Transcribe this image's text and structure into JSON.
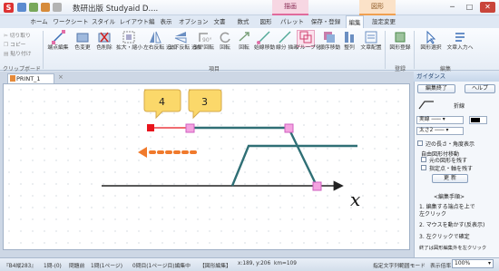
{
  "titlebar": {
    "app_badge": "S",
    "title": "数研出版 Studyaid D....",
    "ctx_drawing": "描画",
    "ctx_shape": "図形",
    "win_min": "─",
    "win_max": "□",
    "win_close": "✕"
  },
  "tabs": [
    {
      "label": "ホーム"
    },
    {
      "label": "ワークシート"
    },
    {
      "label": "スタイル"
    },
    {
      "label": "レイアウト編"
    },
    {
      "label": "表示"
    },
    {
      "label": "オプション"
    },
    {
      "label": "文書"
    },
    {
      "label": "数式"
    },
    {
      "label": "図形"
    },
    {
      "label": "パレット"
    },
    {
      "label": "保存・登録"
    },
    {
      "label": "編集"
    },
    {
      "label": "設定変更"
    }
  ],
  "clipboard": {
    "cut": "切り取り",
    "copy": "コピー",
    "paste": "貼り付け",
    "group": "クリップボード"
  },
  "ribbon": {
    "buttons": [
      "端点編集",
      "色変更",
      "色削除",
      "拡大・縮小",
      "左右反転\n追加",
      "上下反転\n追加",
      "90°回転",
      "回転",
      "回転",
      "始線移動",
      "線分\n描画",
      "グループ化",
      "順序移動",
      "整列",
      "文章配置",
      "図形登録",
      "図形選択",
      "文章入力へ"
    ],
    "group_item": "項目",
    "group_register": "登録",
    "group_edit": "編集"
  },
  "document": {
    "tab_label": "PRINT_1",
    "tab_close": "×",
    "callout_4": "4",
    "callout_3": "3",
    "axis_label": "x"
  },
  "guidance": {
    "header": "ガイダンス",
    "edit_done": "編集終了",
    "help": "ヘルプ",
    "shape_name": "折線",
    "line_style": "実線",
    "line_width": "太さ2",
    "show_length": "辺の長さ・角度表示",
    "free_move": "自由図形付移動",
    "keep_shape": "元の図形を残す",
    "move_axis": "指定点・軸を残す",
    "update": "更 新",
    "edit_header": "<編集手順>",
    "step1": "1. 編集する端点を上で",
    "step1b": "   左クリック",
    "step2": "2. マウスを動かす(反表示)",
    "step3": "3. 左クリックで確定",
    "step4": "終了は図形編集外を左クリック"
  },
  "statusbar": {
    "paper": "『B4縦283』",
    "count": "1問-(0)",
    "question": "問題前",
    "page": "1問(1ページ)",
    "col": "0問目(1ページ目)編集中",
    "mode": "【図形編集】",
    "coords": "x:189, y:206",
    "kin": "km=109",
    "input_mode": "指定文字列範囲モード",
    "display": "表示倍率",
    "zoom": "100%"
  },
  "colors": {
    "accent_pink": "#e26fa8",
    "handle_fill": "#f4a3e0",
    "red_point": "#e8141c",
    "arrow_orange": "#f07a2c",
    "teal_line": "#2f6f75",
    "callout_yellow": "#fbd86a"
  }
}
